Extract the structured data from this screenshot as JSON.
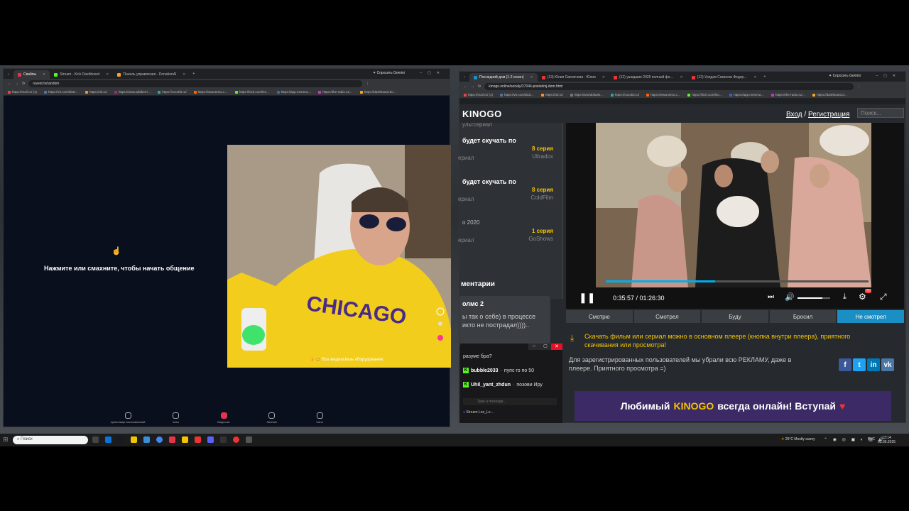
{
  "left_browser": {
    "tabs": [
      {
        "label": "Свайпы",
        "active": true
      },
      {
        "label": "Stream - Kick Dashboard",
        "active": false
      },
      {
        "label": "Панель управления - DonationAl",
        "active": false
      }
    ],
    "ask_gemini": "Спросить Gemini",
    "url": "ruvest.tv/random",
    "bookmarks": [
      "https://mail.ru/ (1)",
      "https://vk.com/id18…",
      "https://ok.ru/",
      "https://www.wildberri…",
      "https://cocobit.ru/",
      "https://www.temu.c…",
      "https://kick.com/leo…",
      "https://app.meneva…",
      "https://the-radio.ru/…",
      "https://dashboard.do…"
    ],
    "prompt": "Нажмите или смахните, чтобы начать общение",
    "cam_overlay": "👍 😊 Все      медиасвязь оборудования",
    "nav": [
      "хранилище воспоминаний",
      "Чаты",
      "Видеочат",
      "Личный",
      "Чаты"
    ]
  },
  "right_browser": {
    "tabs": [
      {
        "label": "Последний дом (1-2 сезон)",
        "active": true
      },
      {
        "label": "(13) Юлия Свиничева - Юлия",
        "active": false
      },
      {
        "label": "(12) ушедшие 2025 полный фо…",
        "active": false
      },
      {
        "label": "(12) Урядов Семенов Федор…",
        "active": false
      }
    ],
    "ask_gemini": "Спросить Gemini",
    "url": "kinogo.online/serialy/27044-poslednij-dom.html",
    "bookmarks": [
      "https://mail.ru/ (1)",
      "https://vk.com/id18…",
      "https://ok.ru/",
      "https://worldoftank…",
      "https://cocobit.ru/",
      "https://www.temu.c…",
      "https://kick.com/leo…",
      "https://app.meneva…",
      "https://the-radio.ru/…",
      "https://dashboard.d…"
    ],
    "site": {
      "logo": "KINOGO",
      "login": "Вход",
      "sep": "/",
      "register": "Регистрация",
      "search_placeholder": "Поиск...",
      "sidebar": {
        "top_fragment": "ультсериал",
        "episodes": [
          {
            "title": "будет скучать по",
            "num": "8 серия",
            "studio": "Ultradox",
            "genre": "ериал"
          },
          {
            "title": "будет скучать по",
            "num": "8 серия",
            "studio": "ColdFilm",
            "genre": "ериал"
          },
          {
            "title": "о   2020",
            "num": "1 серия",
            "studio": "GoShows",
            "genre": "ериал"
          }
        ],
        "comments_heading": "ментарии",
        "comment_author": "олмс 2",
        "comment_text": "ы так о себе) в процессе\nикто не пострадал)))).."
      },
      "player": {
        "time": "0:35:57 / 01:26:30",
        "progress": 0.415,
        "volume": 0.75,
        "hd_badge": "HD"
      },
      "status_tabs": [
        "Смотрю",
        "Смотрел",
        "Буду",
        "Бросил",
        "Не смотрел"
      ],
      "active_status": "Не смотрел",
      "download_note": "Скачать фильм или сериал можно в основном плеере (кнопка внутри плеера), приятного скачивания или просмотра!",
      "register_note": "Для зарегистрированных пользователей мы убрали всю РЕКЛАМУ, даже в плеере. Приятного просмотра =)",
      "social": [
        "f",
        "t",
        "in",
        "vk"
      ],
      "banner": {
        "pre": "Любимый",
        "brand": "KINOGO",
        "post": "всегда онлайн! Вступай"
      }
    }
  },
  "chat": {
    "messages": [
      {
        "user": "",
        "text": "разуме бра?"
      },
      {
        "user": "bubble2033",
        "text": "пупс го по 50"
      },
      {
        "user": "Uhil_yant_zhdun",
        "text": "позови Иру"
      }
    ],
    "input_placeholder": "Type a message...",
    "stream_label": "Stream Leo_Le…"
  },
  "taskbar": {
    "search": "Поиск",
    "weather": "25°C   Mostly sunny",
    "lang": "РУС",
    "time": "13:14",
    "date": "03.06.2025"
  },
  "colors": {
    "accent_blue": "#1b8fc4",
    "kinogo_yellow": "#f5c400",
    "kick_green": "#53fc18",
    "player_progress": "#00aeef"
  }
}
